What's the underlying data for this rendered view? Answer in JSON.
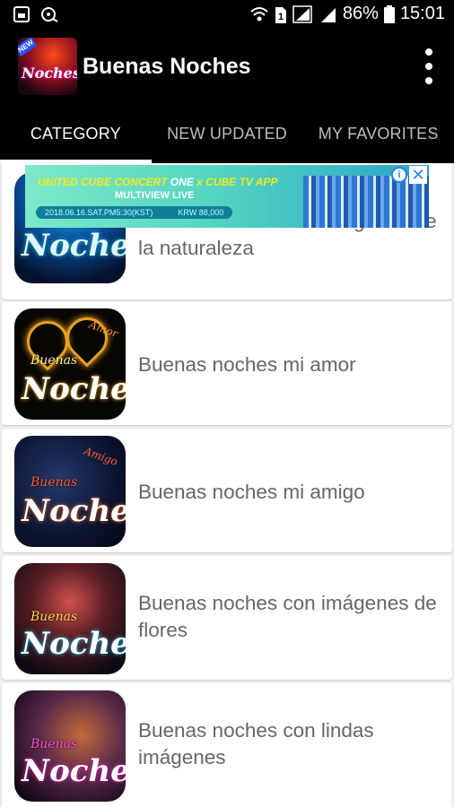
{
  "status_bar": {
    "battery": "86%",
    "time": "15:01"
  },
  "app_bar": {
    "title": "Buenas Noches",
    "logo_text": "Noches",
    "logo_badge": "NEW"
  },
  "tabs": [
    {
      "label": "CATEGORY",
      "active": true
    },
    {
      "label": "NEW UPDATED",
      "active": false
    },
    {
      "label": "MY FAVORITES",
      "active": false
    }
  ],
  "ad": {
    "line1_a": "UNITED CUBE CONCERT",
    "line1_b": "ONE",
    "line1_c": "x CUBE TV APP",
    "line2": "MULTIVIEW LIVE",
    "date": "2018.06.16.SAT.PM5:30(KST)",
    "price": "KRW 88,000",
    "info_icon": "info-icon",
    "close_icon": "close-icon"
  },
  "thumb_text": {
    "small": "Buenas",
    "big": "Noches",
    "amor": "Amor",
    "amigo": "Amigo"
  },
  "categories": [
    {
      "label": "Buenas noches con imágenes de la naturaleza"
    },
    {
      "label": "Buenas noches mi amor"
    },
    {
      "label": "Buenas noches mi amigo"
    },
    {
      "label": "Buenas noches con imágenes de flores"
    },
    {
      "label": "Buenas noches con lindas imágenes"
    }
  ],
  "colors": {
    "accent": "#ffffff",
    "tab_inactive": "#bdbdbd",
    "text": "#666666",
    "background": "#f2f2f2"
  }
}
